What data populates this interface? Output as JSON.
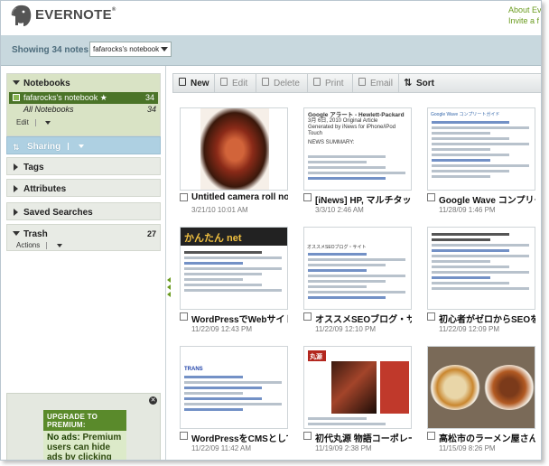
{
  "header": {
    "logo_text": "EVERNOTE",
    "link_about": "About Ev",
    "link_invite": "Invite a f"
  },
  "showbar": {
    "label": "Showing 34 notes in",
    "notebook_select": "fafarocks's notebook"
  },
  "sidebar": {
    "notebooks_title": "Notebooks",
    "notebooks": [
      {
        "label": "fafarocks's notebook ★",
        "count": "34"
      },
      {
        "label": "All Notebooks",
        "count": "34"
      }
    ],
    "notebooks_action": "Edit",
    "sharing_title": "Sharing",
    "tags_title": "Tags",
    "attributes_title": "Attributes",
    "saved_title": "Saved Searches",
    "trash_title": "Trash",
    "trash_count": "27",
    "trash_action": "Actions"
  },
  "ad": {
    "upgrade": "UPGRADE TO PREMIUM:",
    "body_bold": "No ads:",
    "body": "Premium users can hide ads by clicking the"
  },
  "toolbar": {
    "new": "New",
    "edit": "Edit",
    "delete": "Delete",
    "print": "Print",
    "email": "Email",
    "sort": "Sort"
  },
  "notes": [
    {
      "title": "Untitled camera roll note",
      "date": "3/21/10 10:01 AM"
    },
    {
      "title": "[iNews] HP, マルチタッチ",
      "date": "3/3/10 2:46 AM"
    },
    {
      "title": "Google Wave コンプリート",
      "date": "11/28/09 1:46 PM"
    },
    {
      "title": "WordPressでWebサイトを",
      "date": "11/22/09 12:43 PM"
    },
    {
      "title": "オススメSEOブログ・サイト",
      "date": "11/22/09 12:10 PM"
    },
    {
      "title": "初心者がゼロからSEOを学",
      "date": "11/22/09 12:09 PM"
    },
    {
      "title": "WordPressをCMSとして使",
      "date": "11/22/09 11:42 AM"
    },
    {
      "title": "初代丸源 物語コーポレー",
      "date": "11/19/09 2:38 PM"
    },
    {
      "title": "高松市のラーメン屋さん",
      "date": "11/15/09 8:26 PM"
    }
  ],
  "thumb_texts": {
    "hp_title": "Google アラート - Hewlett-Packard",
    "hp_line1": "3月 6日, 2010 Original Article",
    "hp_line2": "Generated by iNews for iPhone/iPod Touch",
    "hp_line3": "NEWS SUMMARY:",
    "wave_header": "Google Wave コンプリートガイド",
    "wp_banner": "かんたん net",
    "seo_header": "オススメSEOブログ・サイト",
    "trans": "TRANS",
    "maru": "丸源"
  },
  "colors": {
    "accent_green": "#6a9b1f",
    "selected_notebook": "#4b7428",
    "sharing_blue": "#aed0e2",
    "showbar": "#c8d8de"
  }
}
